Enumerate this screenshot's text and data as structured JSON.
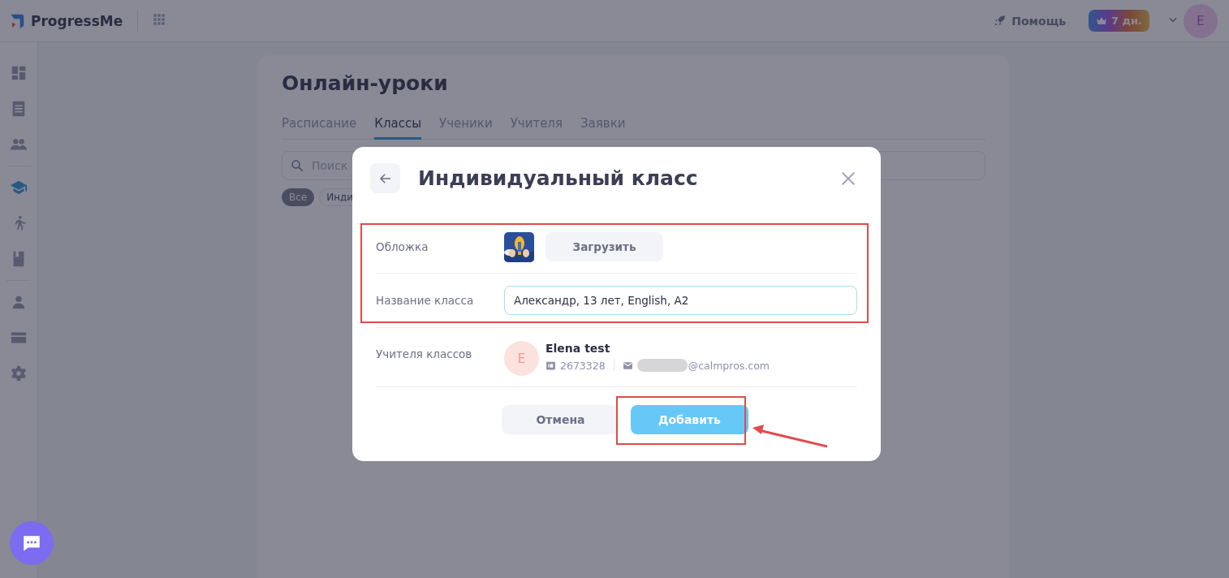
{
  "topbar": {
    "logo": "ProgressMe",
    "help": "Помощь",
    "trial_badge": "7 дн.",
    "avatar": "E"
  },
  "sidebar": {
    "items": [
      {
        "selected": false
      },
      {
        "selected": false
      },
      {
        "selected": false
      },
      {
        "selected": true
      },
      {
        "selected": false
      },
      {
        "selected": false
      },
      {
        "selected": false
      },
      {
        "selected": false
      },
      {
        "selected": false
      }
    ]
  },
  "page": {
    "title": "Онлайн-уроки",
    "tabs": [
      {
        "label": "Расписание",
        "selected": false
      },
      {
        "label": "Классы",
        "selected": true
      },
      {
        "label": "Ученики",
        "selected": false
      },
      {
        "label": "Учителя",
        "selected": false
      },
      {
        "label": "Заявки",
        "selected": false
      }
    ],
    "search": {
      "placeholder": "Поиск"
    },
    "filters": [
      {
        "label": "Все",
        "selected": true
      },
      {
        "label": "Инди",
        "selected": false
      }
    ]
  },
  "dialog": {
    "title": "Индивидуальный класс",
    "cover": {
      "label": "Обложка",
      "button": "Загрузить"
    },
    "class_name": {
      "label": "Название класса",
      "value": "Александр, 13 лет, English, A2"
    },
    "teachers": {
      "label": "Учителя классов",
      "avatar": "E",
      "name": "Elena test",
      "id": "2673328",
      "email": "@calmpros.com"
    },
    "buttons": [
      {
        "label": "Отмена",
        "kind": "secondary"
      },
      {
        "label": "Добавить",
        "kind": "primary"
      }
    ]
  }
}
